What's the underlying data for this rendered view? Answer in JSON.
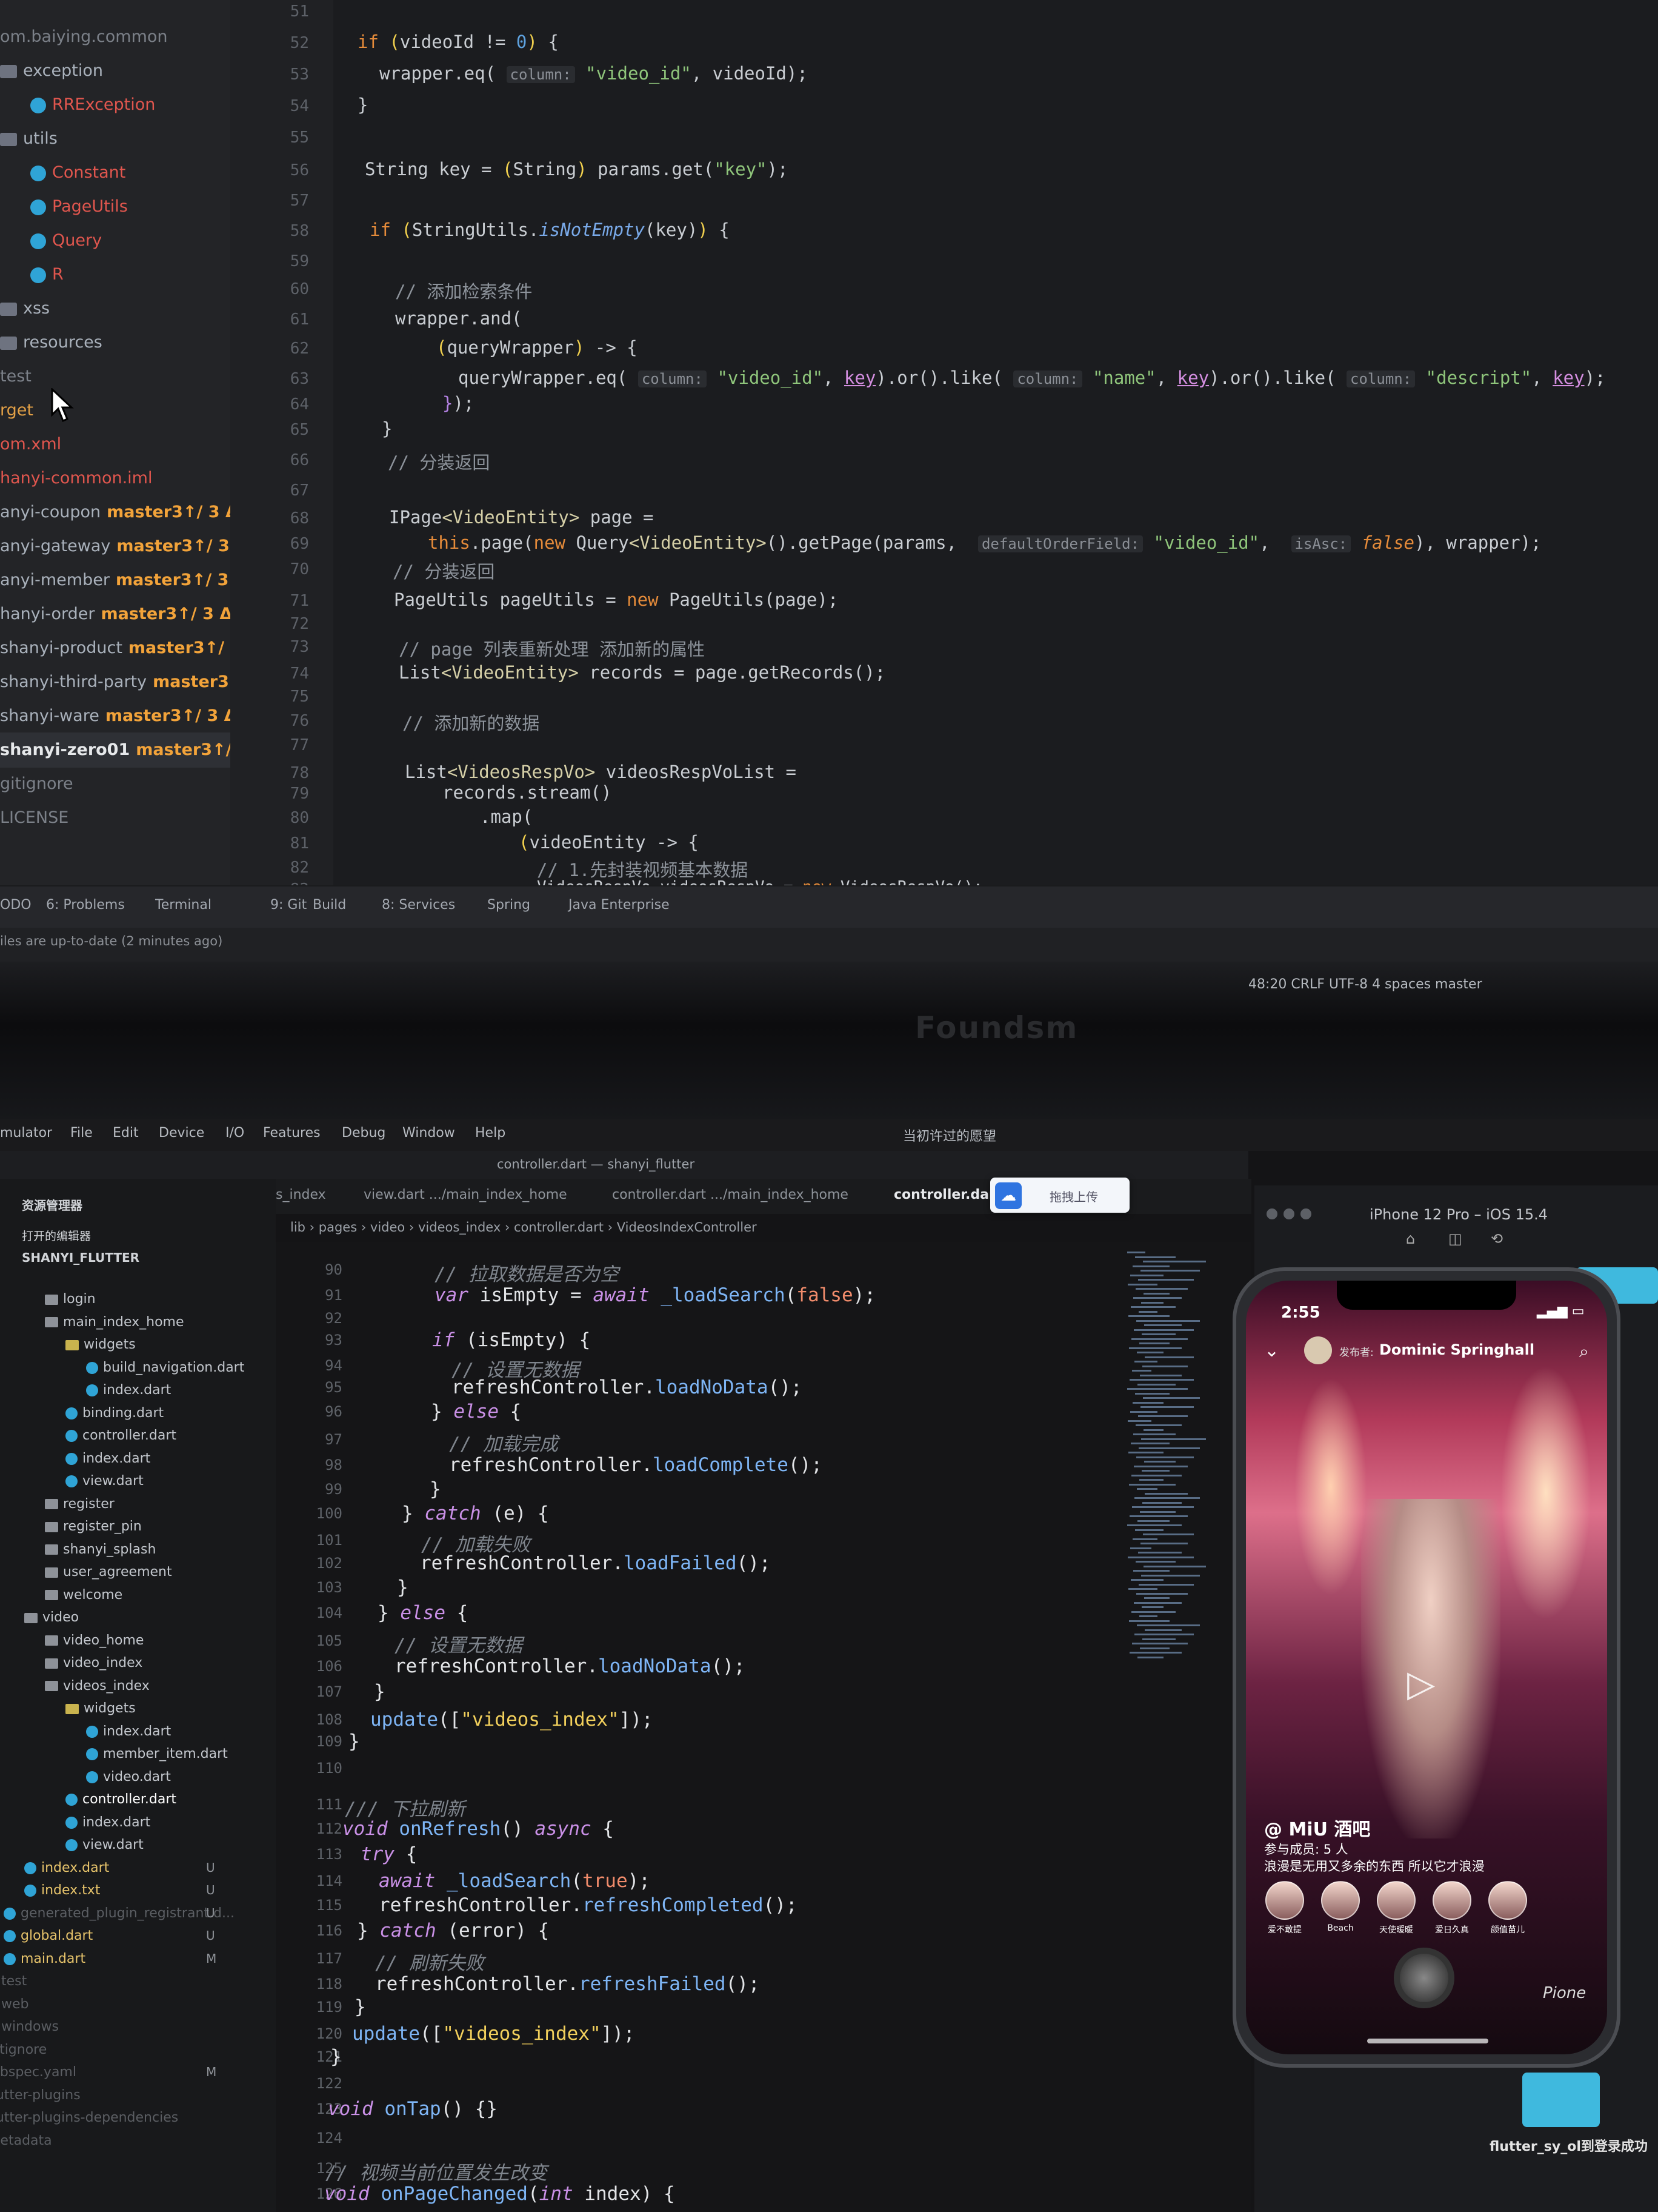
{
  "ij": {
    "tree": [
      {
        "label": "om.baiying.common",
        "type": "text",
        "cls": "grey"
      },
      {
        "label": "exception",
        "type": "folder"
      },
      {
        "label": "RRException",
        "type": "class",
        "cls": "red"
      },
      {
        "label": "utils",
        "type": "folder"
      },
      {
        "label": "Constant",
        "type": "class",
        "cls": "red"
      },
      {
        "label": "PageUtils",
        "type": "class",
        "cls": "red"
      },
      {
        "label": "Query",
        "type": "class",
        "cls": "red"
      },
      {
        "label": "R",
        "type": "class",
        "cls": "red"
      },
      {
        "label": "xss",
        "type": "folder"
      },
      {
        "label": "resources",
        "type": "folder"
      },
      {
        "label": "test",
        "type": "text",
        "cls": "grey"
      },
      {
        "label": "rget",
        "type": "text",
        "cls": "orange"
      },
      {
        "label": "om.xml",
        "type": "text",
        "cls": "red"
      },
      {
        "label": "hanyi-common.iml",
        "type": "text",
        "cls": "red"
      },
      {
        "label": "anyi-coupon",
        "type": "module",
        "branch": "master3↑/ 3 Δ"
      },
      {
        "label": "anyi-gateway",
        "type": "module",
        "branch": "master3↑/ 3 Δ"
      },
      {
        "label": "anyi-member",
        "type": "module",
        "branch": "master3↑/ 3 Δ"
      },
      {
        "label": "hanyi-order",
        "type": "module",
        "branch": "master3↑/ 3 Δ"
      },
      {
        "label": "shanyi-product",
        "type": "module",
        "branch": "master3↑/ 3 Δ"
      },
      {
        "label": "shanyi-third-party",
        "type": "module",
        "branch": "master3↑/ 3 Δ"
      },
      {
        "label": "shanyi-ware",
        "type": "module",
        "branch": "master3↑/ 3 Δ"
      },
      {
        "label": "shanyi-zero01",
        "type": "module",
        "branch": "master3↑/ 3 Δ",
        "selected": true
      },
      {
        "label": "gitignore",
        "type": "text",
        "cls": "grey"
      },
      {
        "label": "LICENSE",
        "type": "text",
        "cls": "grey"
      }
    ],
    "line_numbers": [
      "51",
      "52",
      "53",
      "54",
      "55",
      "56",
      "57",
      "58",
      "59",
      "60",
      "61",
      "62",
      "63",
      "64",
      "65",
      "66",
      "67",
      "68",
      "69",
      "70",
      "71",
      "72",
      "73",
      "74",
      "75",
      "76",
      "77",
      "78",
      "79",
      "80",
      "81",
      "82",
      "83"
    ],
    "toolwindows": [
      "ODO",
      "6: Problems",
      "Terminal",
      "9: Git",
      "Build",
      "8: Services",
      "Spring",
      "Java Enterprise"
    ],
    "status_message": "iles are up-to-date (2 minutes ago)",
    "statusbar": "48:20  CRLF  UTF-8  4 spaces  master"
  },
  "bezel": {
    "brand": "Foundsm"
  },
  "menubar": [
    "mulator",
    "File",
    "Edit",
    "Device",
    "I/O",
    "Features",
    "Debug",
    "Window",
    "Help"
  ],
  "menubar_right": "当初许过的愿望",
  "vs": {
    "title": "controller.dart — shanyi_flutter",
    "explorer_title": "资源管理器",
    "open_editors": "打开的编辑器",
    "project": "SHANYI_FLUTTER",
    "tabs": [
      {
        "label": "s_index",
        "active": false
      },
      {
        "label": "view.dart .../main_index_home",
        "active": false
      },
      {
        "label": "controller.dart .../main_index_home",
        "active": false
      },
      {
        "label": "controller.dart .../videos_index",
        "active": true
      }
    ],
    "breadcrumb": "lib › pages › video › videos_index › controller.dart › VideosIndexController",
    "tree": [
      {
        "label": "login",
        "kind": "folder",
        "indent": 1
      },
      {
        "label": "main_index_home",
        "kind": "folder",
        "indent": 1
      },
      {
        "label": "widgets",
        "kind": "folder-open",
        "indent": 2
      },
      {
        "label": "build_navigation.dart",
        "kind": "dart",
        "indent": 3
      },
      {
        "label": "index.dart",
        "kind": "dart",
        "indent": 3
      },
      {
        "label": "binding.dart",
        "kind": "dart",
        "indent": 2
      },
      {
        "label": "controller.dart",
        "kind": "dart",
        "indent": 2
      },
      {
        "label": "index.dart",
        "kind": "dart",
        "indent": 2
      },
      {
        "label": "view.dart",
        "kind": "dart",
        "indent": 2
      },
      {
        "label": "register",
        "kind": "folder",
        "indent": 1
      },
      {
        "label": "register_pin",
        "kind": "folder",
        "indent": 1
      },
      {
        "label": "shanyi_splash",
        "kind": "folder",
        "indent": 1
      },
      {
        "label": "user_agreement",
        "kind": "folder",
        "indent": 1
      },
      {
        "label": "welcome",
        "kind": "folder",
        "indent": 1
      },
      {
        "label": "video",
        "kind": "folder",
        "indent": 0
      },
      {
        "label": "video_home",
        "kind": "folder",
        "indent": 1
      },
      {
        "label": "video_index",
        "kind": "folder",
        "indent": 1
      },
      {
        "label": "videos_index",
        "kind": "folder",
        "indent": 1
      },
      {
        "label": "widgets",
        "kind": "folder-open",
        "indent": 2
      },
      {
        "label": "index.dart",
        "kind": "dart",
        "indent": 3
      },
      {
        "label": "member_item.dart",
        "kind": "dart",
        "indent": 3
      },
      {
        "label": "video.dart",
        "kind": "dart",
        "indent": 3
      },
      {
        "label": "controller.dart",
        "kind": "dart",
        "indent": 2,
        "active": true
      },
      {
        "label": "index.dart",
        "kind": "dart",
        "indent": 2
      },
      {
        "label": "view.dart",
        "kind": "dart",
        "indent": 2
      },
      {
        "label": "index.dart",
        "kind": "dart",
        "indent": 0,
        "git": "U"
      },
      {
        "label": "index.txt",
        "kind": "dart",
        "indent": 0,
        "git": "U"
      },
      {
        "label": "generated_plugin_registrant.d...",
        "kind": "dart",
        "indent": -1,
        "dim": true,
        "git": "U"
      },
      {
        "label": "global.dart",
        "kind": "dart",
        "indent": -1,
        "git": "U"
      },
      {
        "label": "main.dart",
        "kind": "dart",
        "indent": -1,
        "git": "M"
      },
      {
        "label": "test",
        "kind": "folder",
        "indent": -2,
        "dim": true
      },
      {
        "label": "web",
        "kind": "folder",
        "indent": -2,
        "dim": true
      },
      {
        "label": "windows",
        "kind": "folder",
        "indent": -2,
        "dim": true
      },
      {
        "label": ".gitignore",
        "kind": "text",
        "indent": -2,
        "dim": true
      },
      {
        "label": "pubspec.yaml",
        "kind": "text",
        "indent": -2,
        "dim": true,
        "git": "M"
      },
      {
        "label": ".flutter-plugins",
        "kind": "text",
        "indent": -2,
        "dim": true
      },
      {
        "label": ".flutter-plugins-dependencies",
        "kind": "text",
        "indent": -2,
        "dim": true
      },
      {
        "label": ".metadata",
        "kind": "text",
        "indent": -2,
        "dim": true
      }
    ],
    "line_numbers": [
      "90",
      "91",
      "92",
      "93",
      "94",
      "95",
      "96",
      "97",
      "98",
      "99",
      "100",
      "101",
      "102",
      "103",
      "104",
      "105",
      "106",
      "107",
      "108",
      "109",
      "110",
      "111",
      "112",
      "113",
      "114",
      "115",
      "116",
      "117",
      "118",
      "119",
      "120",
      "121",
      "122",
      "123",
      "124",
      "125",
      "126"
    ]
  },
  "upload": {
    "label": "拖拽上传"
  },
  "sim": {
    "title": "iPhone 12 Pro – iOS 15.4",
    "time": "2:55",
    "author_prefix": "发布者:",
    "author_name": "Dominic Springhall",
    "room_name": "@ MiU 酒吧",
    "room_members": "参与成员: 5 人",
    "room_desc": "浪漫是无用又多余的东西 所以它才浪漫",
    "members": [
      "爱不敢提",
      "Beach",
      "天使暖暖",
      "爱日久真",
      "颜值苗儿"
    ],
    "watermark": "Pione"
  },
  "toast": {
    "text": "flutter_sy_ol到登录成功"
  }
}
